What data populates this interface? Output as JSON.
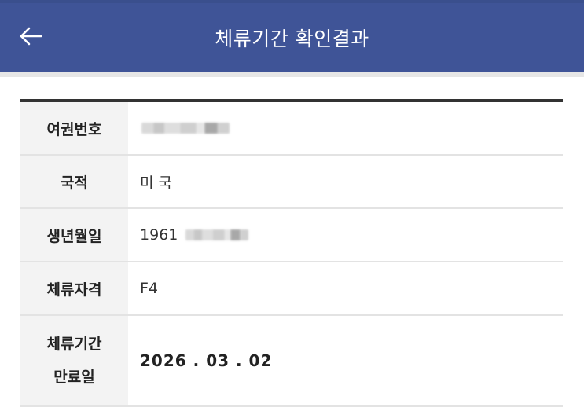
{
  "header": {
    "title": "체류기간 확인결과",
    "back_icon": "arrow-left-icon"
  },
  "colors": {
    "header_bg": "#3f5497",
    "label_bg": "#f3f3f3",
    "table_top_border": "#333333"
  },
  "rows": [
    {
      "label": "여권번호",
      "value": ""
    },
    {
      "label": "국적",
      "value": "미 국"
    },
    {
      "label": "생년월일",
      "value": "1961"
    },
    {
      "label": "체류자격",
      "value": "F4"
    },
    {
      "label_line1": "체류기간",
      "label_line2": "만료일",
      "value": "2026 . 03 . 02"
    }
  ]
}
